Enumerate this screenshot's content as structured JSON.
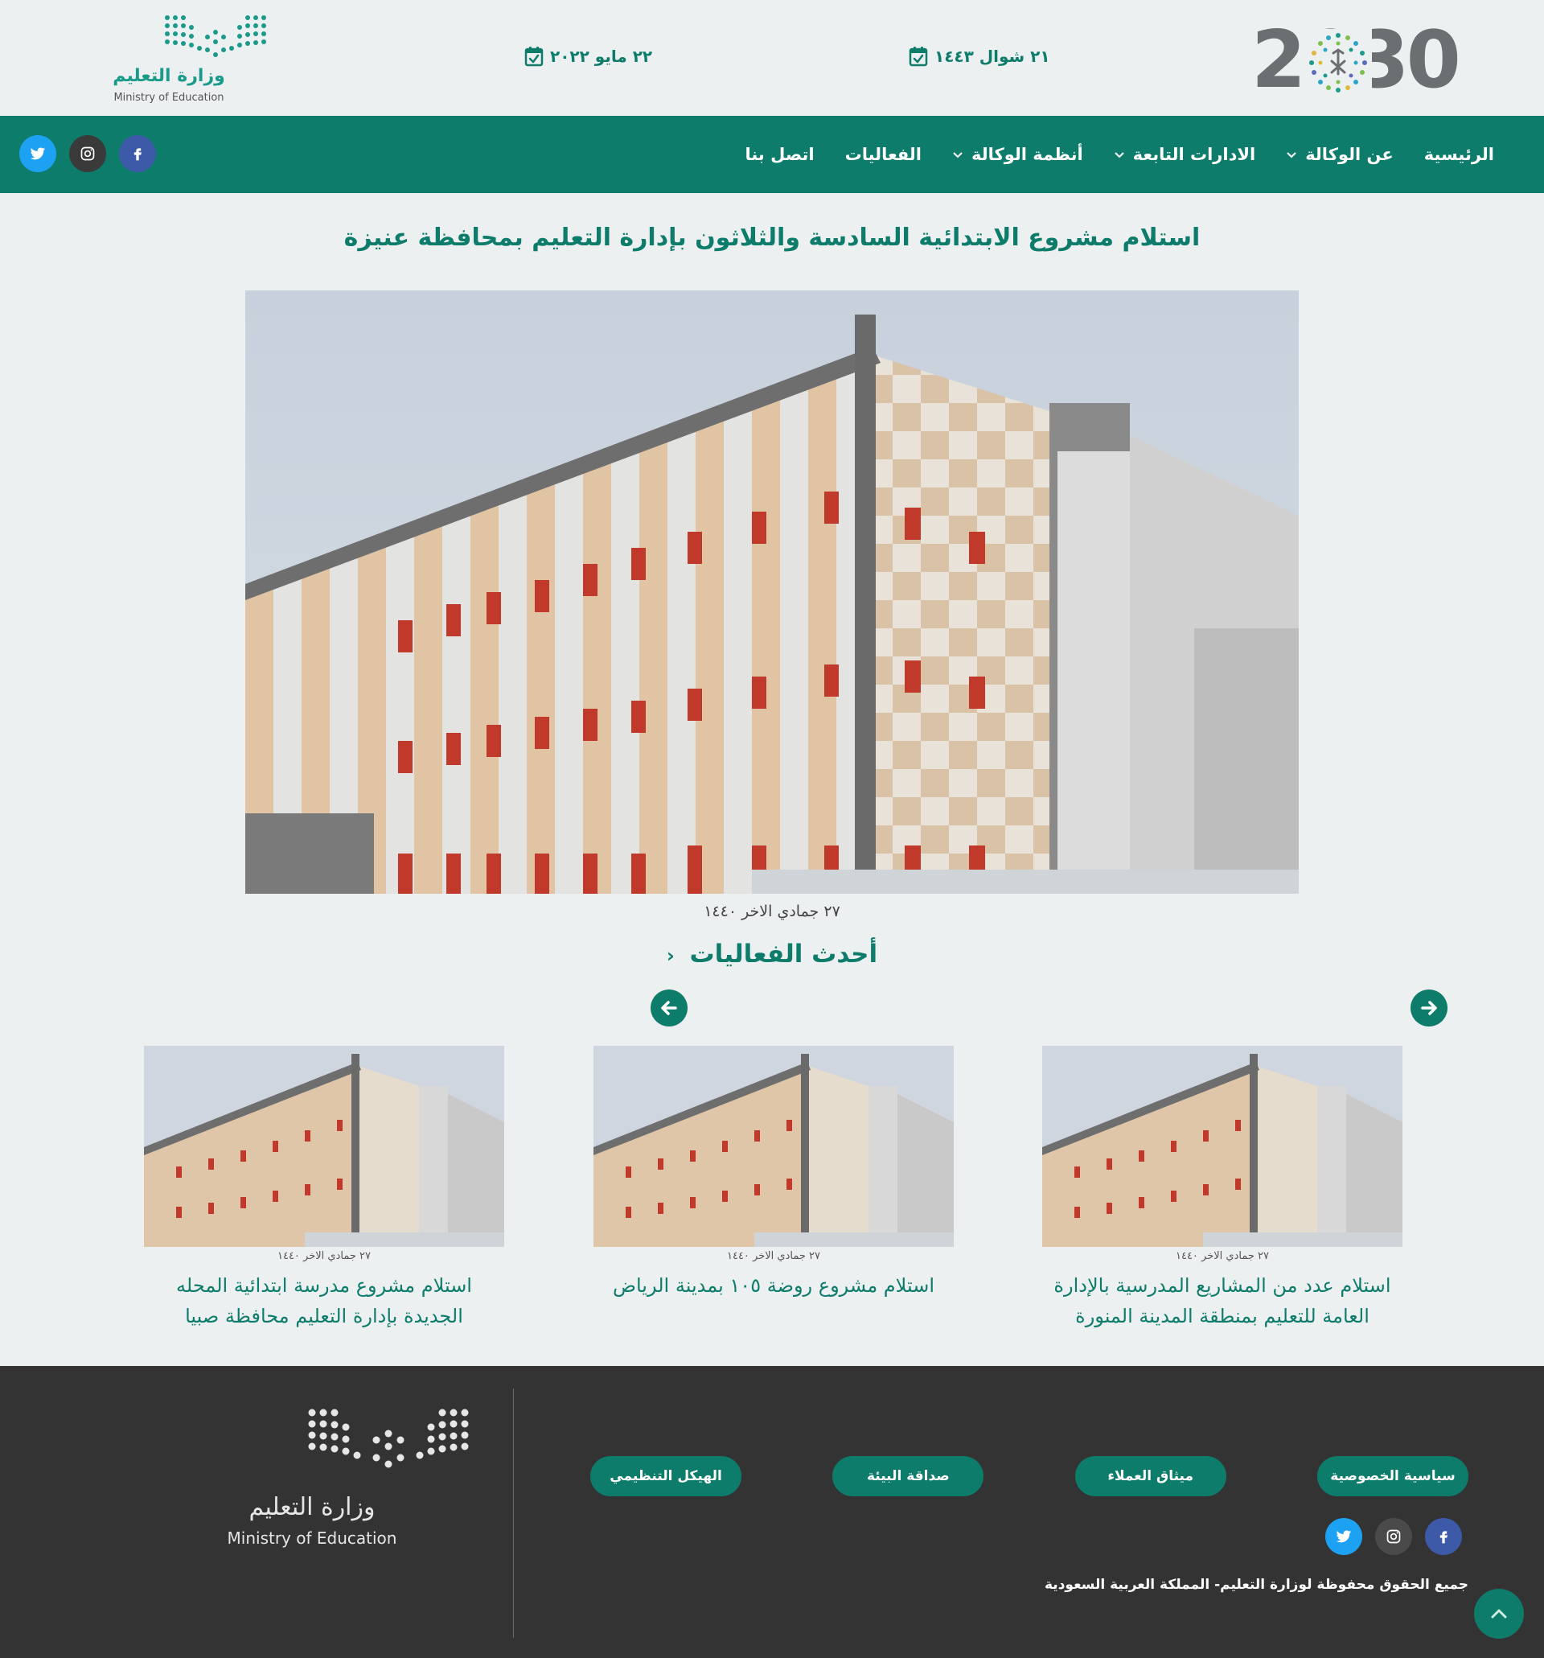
{
  "header": {
    "vision_logo_text": "2030",
    "hijri_date": "٢١ شوال ١٤٤٣",
    "gregorian_date": "٢٢ مايو ٢٠٢٢",
    "moe_logo_ar": "وزارة التعليم",
    "moe_logo_en": "Ministry of Education",
    "calendar_icon": "calendar-check-icon"
  },
  "nav": {
    "items": [
      {
        "label": "الرئيسية",
        "has_dropdown": false
      },
      {
        "label": "عن الوكالة",
        "has_dropdown": true
      },
      {
        "label": "الادارات التابعة",
        "has_dropdown": true
      },
      {
        "label": "أنظمة الوكالة",
        "has_dropdown": true
      },
      {
        "label": "الفعاليات",
        "has_dropdown": false
      },
      {
        "label": "اتصل بنا",
        "has_dropdown": false
      }
    ],
    "social": [
      "twitter-icon",
      "instagram-icon",
      "facebook-icon"
    ]
  },
  "article": {
    "title": "استلام مشروع الابتدائية السادسة والثلاثون بإدارة التعليم بمحافظة عنيزة",
    "date": "٢٧ جمادي الاخر ١٤٤٠"
  },
  "events": {
    "section_title": "أحدث الفعاليات",
    "cards": [
      {
        "date": "٢٧ جمادي الاخر ١٤٤٠",
        "title": "استلام عدد من المشاريع المدرسية بالإدارة العامة للتعليم بمنطقة المدينة المنورة"
      },
      {
        "date": "٢٧ جمادي الاخر ١٤٤٠",
        "title": "استلام مشروع روضة ١٠٥ بمدينة الرياض"
      },
      {
        "date": "٢٧ جمادي الاخر ١٤٤٠",
        "title": "استلام مشروع مدرسة ابتدائية المحله الجديدة بإدارة التعليم محافظة صبيا"
      }
    ]
  },
  "footer": {
    "links": [
      "سياسية الخصوصية",
      "ميثاق العملاء",
      "صداقة البيئة",
      "الهيكل التنظيمي"
    ],
    "copyright": "جميع الحقوق محفوظة لوزارة التعليم- المملكة العربية السعودية",
    "moe_logo_ar": "وزارة التعليم",
    "moe_logo_en": "Ministry of Education"
  },
  "colors": {
    "primary": "#0e7c6b",
    "background": "#edf0f1",
    "footer_bg": "#333333",
    "twitter": "#1da1f2",
    "facebook": "#3d5aa8",
    "instagram": "#3a3a3a"
  }
}
